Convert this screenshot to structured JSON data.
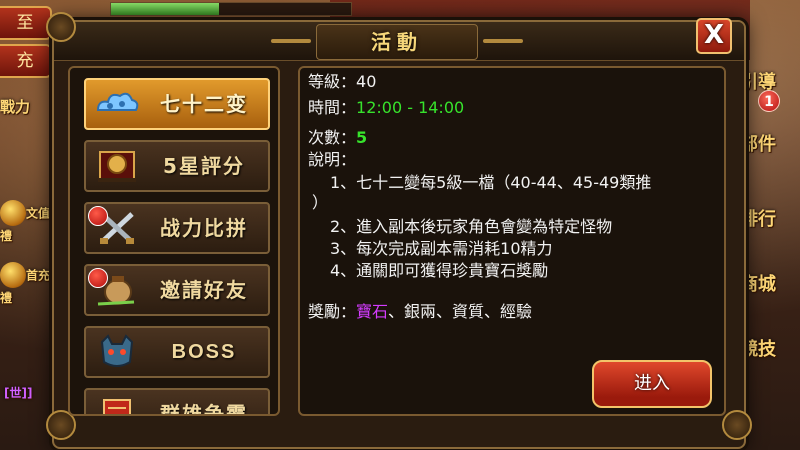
{
  "hud": {
    "left_buttons": [
      "至",
      "充"
    ],
    "left_tiles": [
      "戰力",
      "文值禮",
      "首充禮",
      "[世]]"
    ],
    "right_tiles": [
      "引導",
      "部件",
      "排行",
      "商城",
      "競技"
    ],
    "guide_badge": "1"
  },
  "dialog": {
    "title": "活動",
    "close_label": "X",
    "activities": [
      {
        "label": "七十二变",
        "icon": "cloud-icon",
        "selected": true,
        "red_dot": false
      },
      {
        "label": "5星評分",
        "icon": "gong-icon",
        "selected": false,
        "red_dot": false
      },
      {
        "label": "战力比拼",
        "icon": "crossed-swords-icon",
        "selected": false,
        "red_dot": true
      },
      {
        "label": "邀請好友",
        "icon": "wine-jar-icon",
        "selected": false,
        "red_dot": true
      },
      {
        "label": "BOSS",
        "icon": "demon-mask-icon",
        "selected": false,
        "red_dot": false
      },
      {
        "label": "群雄争霸",
        "icon": "banner-icon",
        "selected": false,
        "red_dot": false
      }
    ],
    "detail": {
      "level_label": "等級：",
      "level_value": "40",
      "time_label": "時間：",
      "time_value": "12:00 - 14:00",
      "count_label": "次數：",
      "count_value": "5",
      "desc_label": "說明：",
      "desc_items": [
        "1、七十二變每5級一檔（40-44、45-49類推",
        "）",
        "2、進入副本後玩家角色會變為特定怪物",
        "3、每次完成副本需消耗10精力",
        "4、通關即可獲得珍貴寶石獎勵"
      ],
      "reward_label": "獎勵：",
      "reward_highlight": "寶石",
      "reward_rest": "、銀兩、資質、經驗"
    },
    "enter_label": "进入"
  },
  "colors": {
    "highlight_green": "#37e22c",
    "highlight_purple": "#d43cff",
    "accent_gold": "#f6d77a",
    "button_red": "#c8321e"
  }
}
